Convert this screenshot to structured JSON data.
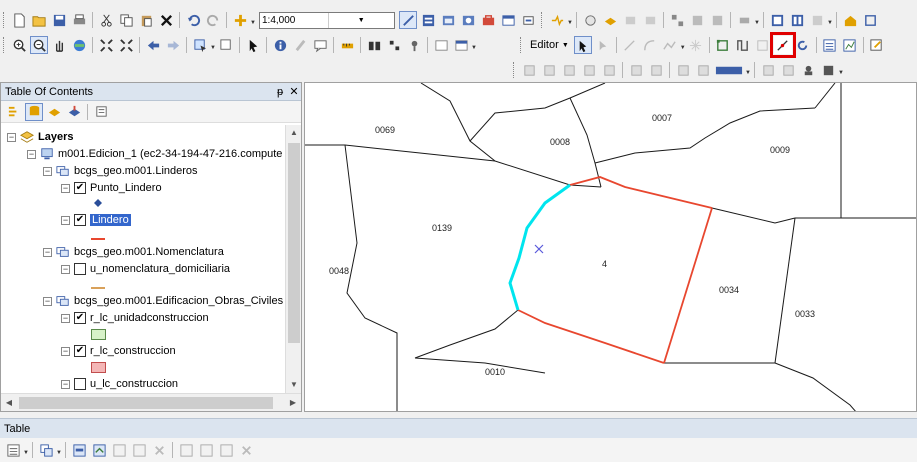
{
  "toolbar_row1": {
    "scale_value": "1:4,000"
  },
  "toolbar_row2": {
    "editor_label": "Editor"
  },
  "toc": {
    "title": "Table Of Contents",
    "pin": "↕",
    "close": "✕",
    "items": [
      {
        "label": "Layers"
      },
      {
        "label": "m001.Edicion_1 (ec2-34-194-47-216.compute"
      },
      {
        "label": "bcgs_geo.m001.Linderos"
      },
      {
        "label": "Punto_Lindero"
      },
      {
        "label": "Lindero"
      },
      {
        "label": "bcgs_geo.m001.Nomenclatura"
      },
      {
        "label": "u_nomenclatura_domiciliaria"
      },
      {
        "label": "bcgs_geo.m001.Edificacion_Obras_Civiles"
      },
      {
        "label": "r_lc_unidadconstruccion"
      },
      {
        "label": "r_lc_construccion"
      },
      {
        "label": "u_lc_construccion"
      }
    ],
    "checked": [
      true,
      true,
      false,
      true,
      true,
      false
    ]
  },
  "colors": {
    "selected_edge": "#00e5ee",
    "lindero": "#e8472f",
    "highlight_box": "#e00000",
    "selection_bg": "#3366cc",
    "unidad_fill": "#d7f2c8",
    "construccion_fill": "#f4b6b6"
  },
  "map": {
    "parcels": [
      {
        "label": "0069"
      },
      {
        "label": "0007"
      },
      {
        "label": "0008"
      },
      {
        "label": "0009"
      },
      {
        "label": "0139"
      },
      {
        "label": "4"
      },
      {
        "label": "0048"
      },
      {
        "label": "0034"
      },
      {
        "label": "0033"
      },
      {
        "label": "0010"
      }
    ]
  },
  "table": {
    "title": "Table"
  }
}
